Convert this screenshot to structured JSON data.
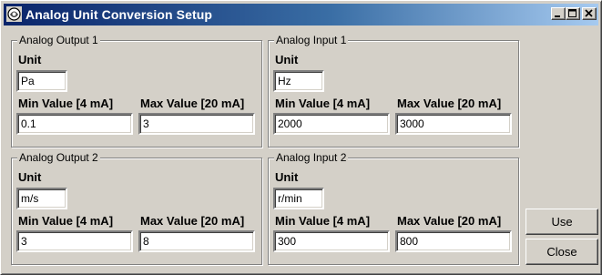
{
  "window": {
    "title": "Analog Unit Conversion Setup",
    "icon": "app-icon",
    "controls": [
      "minimize-icon",
      "maximize-icon",
      "close-icon"
    ]
  },
  "labels": {
    "unit": "Unit",
    "min": "Min Value [4 mA]",
    "max": "Max Value [20 mA]"
  },
  "groups": [
    {
      "title": "Analog Output 1",
      "unit": "Pa",
      "min": "0.1",
      "max": "3"
    },
    {
      "title": "Analog Input 1",
      "unit": "Hz",
      "min": "2000",
      "max": "3000"
    },
    {
      "title": "Analog Output 2",
      "unit": "m/s",
      "min": "3",
      "max": "8"
    },
    {
      "title": "Analog Input 2",
      "unit": "r/min",
      "min": "300",
      "max": "800"
    }
  ],
  "buttons": {
    "use": "Use",
    "close": "Close"
  },
  "colors": {
    "title_start": "#0a246a",
    "title_end": "#a6caf0",
    "face": "#d4d0c8"
  }
}
